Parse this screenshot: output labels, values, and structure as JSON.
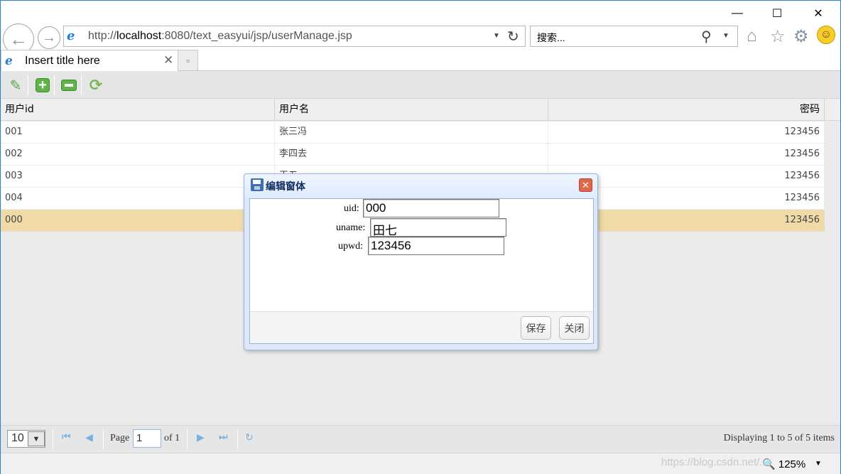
{
  "window": {
    "minimize_glyph": "—",
    "maximize_glyph": "☐",
    "close_glyph": "✕"
  },
  "address_bar": {
    "url_prefix": "http://",
    "url_host": "localhost",
    "url_rest": ":8080/text_easyui/jsp/userManage.jsp",
    "search_placeholder": "搜索..."
  },
  "tab": {
    "title": "Insert title here",
    "close_glyph": "✕"
  },
  "toolbar": {
    "icons": [
      "edit-icon",
      "add-icon",
      "remove-icon",
      "reload-icon"
    ]
  },
  "grid": {
    "columns": [
      "用户id",
      "用户名",
      "密码"
    ],
    "rows": [
      [
        "001",
        "张三冯",
        "123456"
      ],
      [
        "002",
        "李四去",
        "123456"
      ],
      [
        "003",
        "王五",
        "123456"
      ],
      [
        "004",
        "",
        "123456"
      ],
      [
        "000",
        "",
        "123456"
      ]
    ],
    "selected_row": 4
  },
  "pager": {
    "page_size": "10",
    "page_label": "Page",
    "page_value": "1",
    "of_label": "of 1",
    "info": "Displaying 1 to 5 of 5 items"
  },
  "dialog": {
    "title": "编辑窗体",
    "fields": [
      {
        "label": "uid:",
        "value": "000"
      },
      {
        "label": "uname:",
        "value": "田七"
      },
      {
        "label": "upwd:",
        "value": "123456"
      }
    ],
    "save_label": "保存",
    "close_label": "关闭"
  },
  "statusbar": {
    "zoom": "125%",
    "watermark": "https://blog.csdn.net/..."
  }
}
